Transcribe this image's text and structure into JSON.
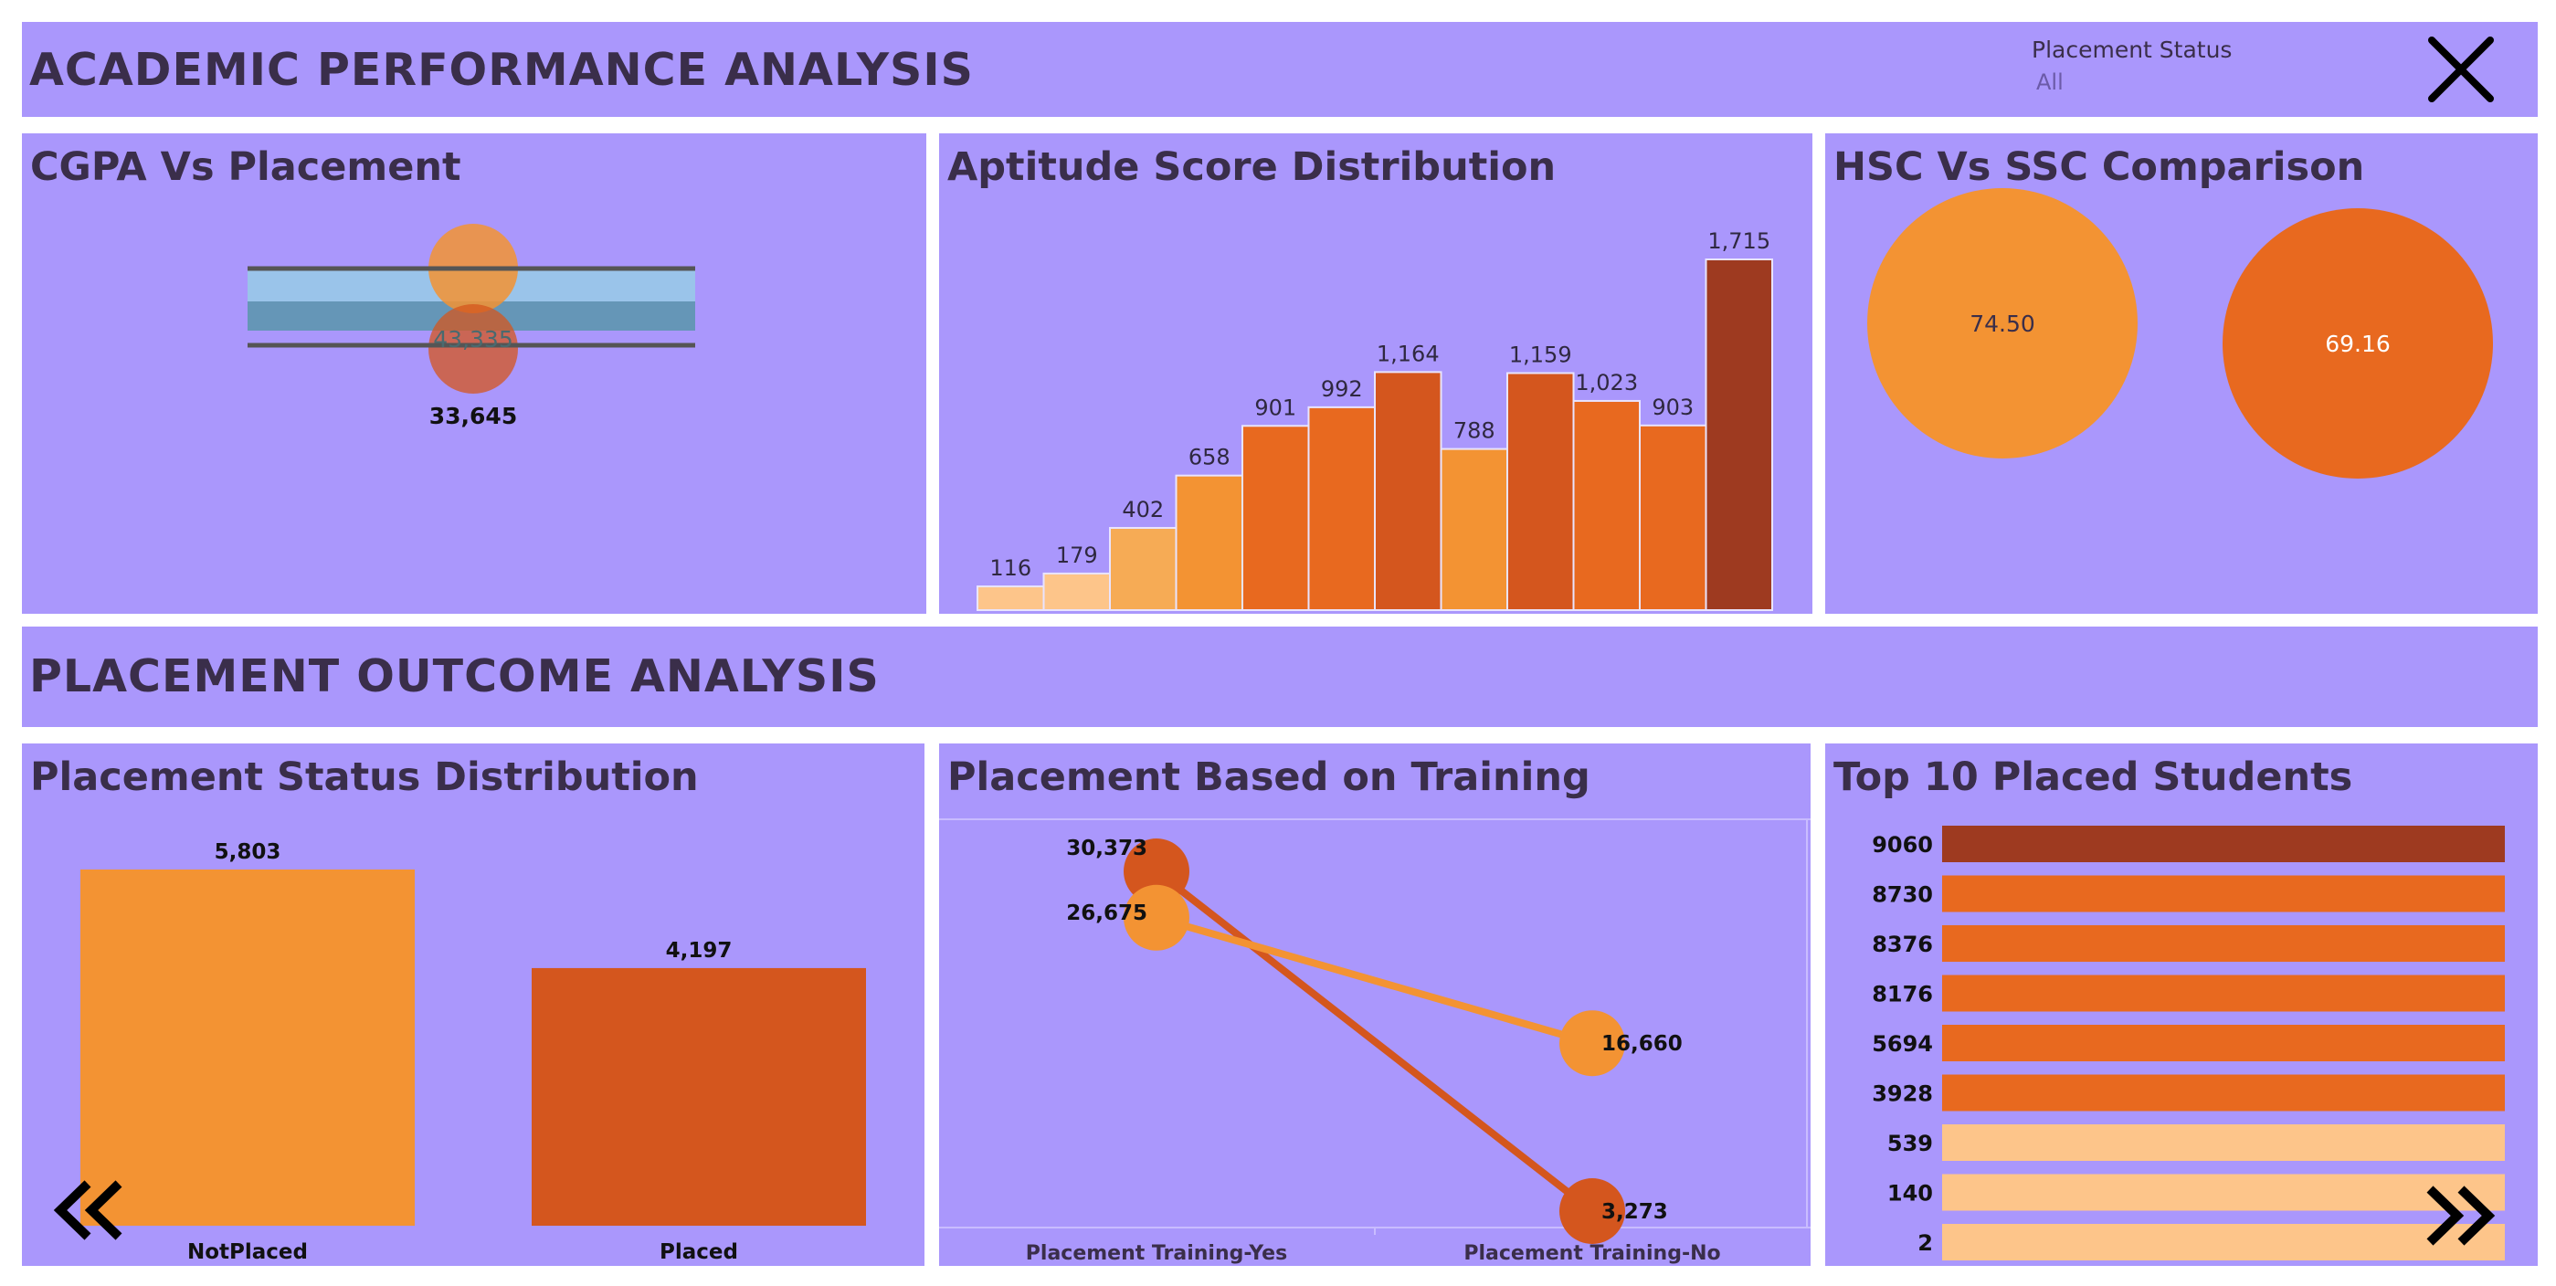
{
  "header": {
    "title": "ACADEMIC PERFORMANCE ANALYSIS",
    "filter_label": "Placement Status",
    "filter_value": "All",
    "close_icon": "close-icon"
  },
  "section2": {
    "title": "PLACEMENT OUTCOME ANALYSIS"
  },
  "colors": {
    "panel": "#aa97fc",
    "dark_text": "#3a2e4a",
    "light_orange": "#fdc58a",
    "mid_orange": "#f39333",
    "orange": "#e8691f",
    "dark_orange": "#d4561e",
    "brown": "#9e3a20"
  },
  "nav": {
    "back_icon": "double-chevron-left-icon",
    "forward_icon": "double-chevron-right-icon"
  },
  "chart_data": [
    {
      "id": "cgpa",
      "type": "scatter",
      "title": "CGPA Vs Placement",
      "labels": [
        "43,335",
        "33,645"
      ],
      "values": [
        43335,
        33645
      ]
    },
    {
      "id": "aptitude",
      "type": "bar",
      "title": "Aptitude Score Distribution",
      "values": [
        116,
        179,
        402,
        658,
        901,
        992,
        1164,
        788,
        1159,
        1023,
        903,
        1715
      ],
      "labels": [
        "116",
        "179",
        "402",
        "658",
        "901",
        "992",
        "1,164",
        "788",
        "1,159",
        "1,023",
        "903",
        "1,715"
      ],
      "ylim": [
        0,
        1715
      ]
    },
    {
      "id": "hsc_ssc",
      "type": "scatter",
      "title": "HSC Vs SSC Comparison",
      "values": [
        74.5,
        69.16
      ],
      "labels": [
        "74.50",
        "69.16"
      ]
    },
    {
      "id": "status",
      "type": "bar",
      "title": "Placement Status Distribution",
      "categories": [
        "NotPlaced",
        "Placed"
      ],
      "values": [
        5803,
        4197
      ],
      "labels": [
        "5,803",
        "4,197"
      ]
    },
    {
      "id": "training",
      "type": "line",
      "title": "Placement Based on Training",
      "categories": [
        "Placement Training-Yes",
        "Placement Training-No"
      ],
      "series": [
        {
          "values": [
            30373,
            3273
          ],
          "labels": [
            "30,373",
            "3,273"
          ]
        },
        {
          "values": [
            26675,
            16660
          ],
          "labels": [
            "26,675",
            "16,660"
          ]
        }
      ]
    },
    {
      "id": "top10",
      "type": "bar",
      "title": "Top 10 Placed Students",
      "categories": [
        "9060",
        "8730",
        "8376",
        "8176",
        "5694",
        "3928",
        "539",
        "140",
        "2"
      ]
    }
  ]
}
